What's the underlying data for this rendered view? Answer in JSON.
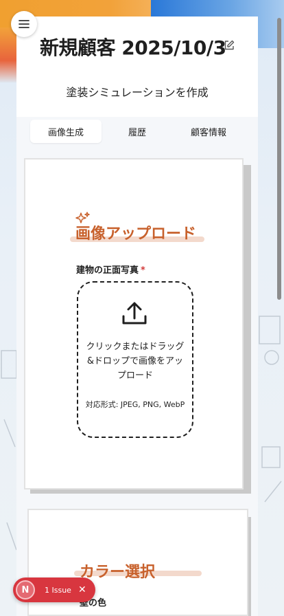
{
  "header": {
    "title": "新規顧客 2025/10/3",
    "subtitle": "塗装シミュレーションを作成"
  },
  "tabs": [
    {
      "label": "画像生成",
      "active": true
    },
    {
      "label": "履歴",
      "active": false
    },
    {
      "label": "顧客情報",
      "active": false
    }
  ],
  "upload_section": {
    "title": "画像アップロード",
    "field_label": "建物の正面写真",
    "required_mark": "*",
    "dropzone_text": "クリックまたはドラッグ&ドロップで画像をアップロード",
    "formats": "対応形式: JPEG, PNG, WebP"
  },
  "color_section": {
    "title": "カラー選択",
    "field_label": "壁の色"
  },
  "issue_badge": {
    "avatar_letter": "N",
    "label": "1 Issue",
    "close": "✕"
  },
  "colors": {
    "accent": "#c8612c",
    "issue_red": "#d8363f",
    "required": "#d23a3a"
  },
  "icons": [
    "menu-icon",
    "edit-icon",
    "sparkle-icon",
    "upload-icon",
    "close-icon"
  ]
}
